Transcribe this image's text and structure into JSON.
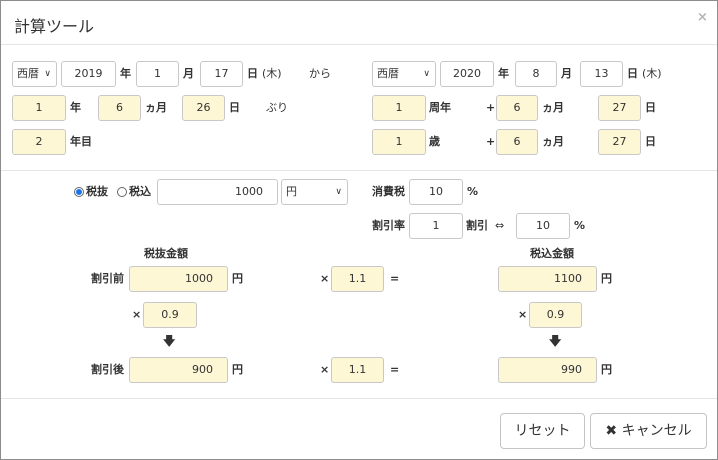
{
  "title": "計算ツール",
  "close_icon": "×",
  "row1_left": {
    "era": "西暦",
    "year": "2019",
    "year_unit": "年",
    "month": "1",
    "month_unit": "月",
    "day": "17",
    "day_unit": "日",
    "weekday": "(木)",
    "from": "から"
  },
  "row1_right": {
    "era": "西暦",
    "year": "2020",
    "year_unit": "年",
    "month": "8",
    "month_unit": "月",
    "day": "13",
    "day_unit": "日",
    "weekday": "(木)"
  },
  "duration": {
    "years": "1",
    "years_unit": "年",
    "months": "6",
    "months_unit": "ヵ月",
    "days": "26",
    "days_unit": "日",
    "suffix": "ぶり"
  },
  "nth_year": {
    "value": "2",
    "unit": "年目"
  },
  "anniversary": {
    "years": "1",
    "years_unit": "周年",
    "plus": "+",
    "months": "6",
    "months_unit": "ヵ月",
    "days": "27",
    "days_unit": "日"
  },
  "age": {
    "years": "1",
    "years_unit": "歳",
    "plus": "+",
    "months": "6",
    "months_unit": "ヵ月",
    "days": "27",
    "days_unit": "日"
  },
  "tax": {
    "radio_excl": "税抜",
    "radio_incl": "税込",
    "amount": "1000",
    "currency": "円",
    "consumption_label": "消費税",
    "consumption_rate": "10",
    "percent": "%",
    "discount_label": "割引率",
    "discount_value": "1",
    "discount_unit": "割引",
    "equiv": "⇔",
    "discount_percent": "10",
    "col_excl": "税抜金額",
    "col_incl": "税込金額",
    "before_label": "割引前",
    "after_label": "割引後",
    "before_excl": "1000",
    "before_incl": "1100",
    "times": "×",
    "equals": "=",
    "multiplier": "1.1",
    "discount_factor": "0.9",
    "after_excl": "900",
    "after_incl": "990",
    "yen": "円",
    "down_arrow": "🡇"
  },
  "footer": {
    "reset": "リセット",
    "cancel_icon": "✖",
    "cancel": "キャンセル"
  }
}
